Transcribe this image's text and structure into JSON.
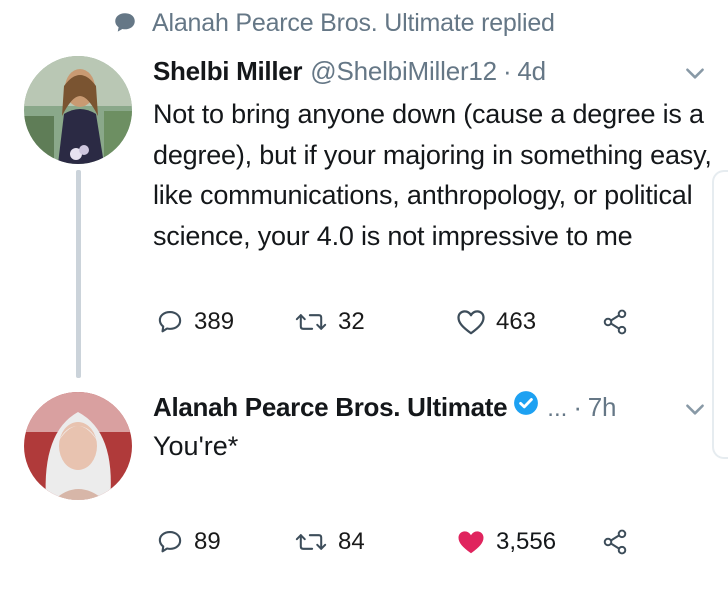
{
  "context": {
    "text": "Alanah Pearce Bros. Ultimate replied"
  },
  "tweet1": {
    "name": "Shelbi Miller",
    "handle": "@ShelbiMiller12",
    "separator": "·",
    "time": "4d",
    "text": "Not to bring anyone down (cause a degree is a degree), but if your majoring in something easy, like communications, anthropology,  or political science, your 4.0 is not impressive to me",
    "replies": "389",
    "retweets": "32",
    "likes": "463"
  },
  "tweet2": {
    "name": "Alanah Pearce Bros. Ultimate",
    "ellipsis": "...",
    "separator": "·",
    "time": "7h",
    "text": "You're*",
    "replies": "89",
    "retweets": "84",
    "likes": "3,556"
  },
  "colors": {
    "secondary_text": "#657786",
    "verified_blue": "#1da1f2",
    "like_red": "#e0245e",
    "thread_line": "#cbd3da"
  }
}
